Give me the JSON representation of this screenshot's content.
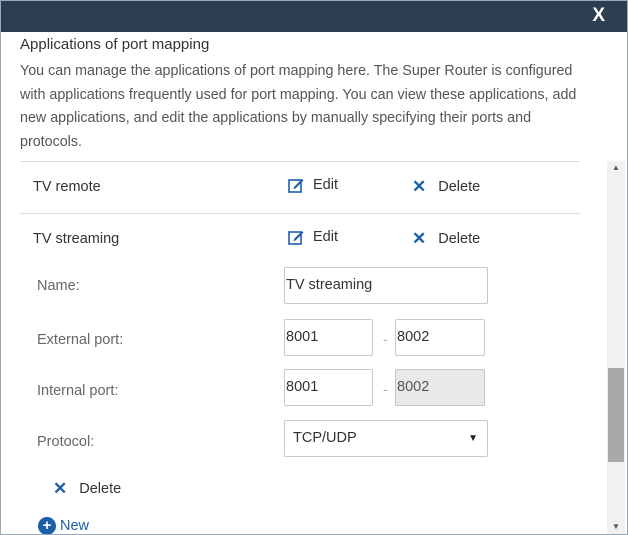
{
  "dialog": {
    "close_label": "X",
    "heading": "Applications of port mapping",
    "description": "You can manage the applications of port mapping here. The Super Router is configured with applications frequently used for port mapping. You can view these applications, add new applications, and edit the applications by manually specifying their ports and protocols."
  },
  "apps": [
    {
      "name": "TV remote",
      "edit_label": "Edit",
      "delete_label": "Delete"
    },
    {
      "name": "TV streaming",
      "edit_label": "Edit",
      "delete_label": "Delete"
    }
  ],
  "form": {
    "name_label": "Name:",
    "name_value": "TV streaming",
    "external_label": "External port:",
    "external_start": "8001",
    "external_end": "8002",
    "internal_label": "Internal port:",
    "internal_start": "8001",
    "internal_end": "8002",
    "range_separator": "-",
    "protocol_label": "Protocol:",
    "protocol_value": "TCP/UDP",
    "protocol_arrow": "▼",
    "delete_label": "Delete"
  },
  "new_label": "New",
  "icons": {
    "close": "close-icon",
    "edit": "edit-icon",
    "delete": "x-icon",
    "add": "plus-icon"
  },
  "colors": {
    "titlebar": "#2c3e50",
    "accent": "#1d5ea8"
  }
}
